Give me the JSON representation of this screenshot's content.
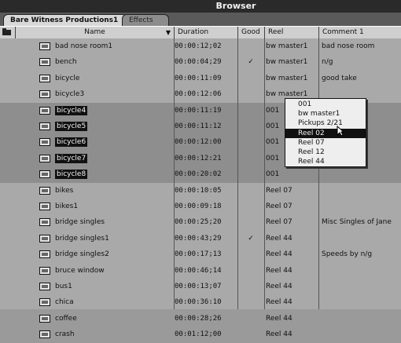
{
  "window": {
    "title": "Browser"
  },
  "tabs": [
    {
      "label": "Bare Witness Productions1",
      "active": true
    },
    {
      "label": "Effects",
      "active": false
    }
  ],
  "columns": {
    "name": "Name",
    "duration": "Duration",
    "good": "Good",
    "reel": "Reel",
    "comment": "Comment 1"
  },
  "rows": [
    {
      "name": "bad nose room1",
      "duration": "00:00:12;02",
      "good": "",
      "reel": "bw master1",
      "comment": "bad nose room",
      "selected": false
    },
    {
      "name": "bench",
      "duration": "00:00:04;29",
      "good": "✓",
      "reel": "bw master1",
      "comment": "n/g",
      "selected": false
    },
    {
      "name": "bicycle",
      "duration": "00:00:11:09",
      "good": "",
      "reel": "bw master1",
      "comment": "good take",
      "selected": false
    },
    {
      "name": "bicycle3",
      "duration": "00:00:12:06",
      "good": "",
      "reel": "bw master1",
      "comment": "",
      "selected": false
    },
    {
      "name": "bicycle4",
      "duration": "00:00:11:19",
      "good": "",
      "reel": "001",
      "comment": "",
      "selected": true
    },
    {
      "name": "bicycle5",
      "duration": "00:00:11:12",
      "good": "",
      "reel": "001",
      "comment": "",
      "selected": true
    },
    {
      "name": "bicycle6",
      "duration": "00:00:12:00",
      "good": "",
      "reel": "001",
      "comment": "",
      "selected": true
    },
    {
      "name": "bicycle7",
      "duration": "00:00:12:21",
      "good": "",
      "reel": "001",
      "comment": "",
      "selected": true
    },
    {
      "name": "bicycle8",
      "duration": "00:00:20:02",
      "good": "",
      "reel": "001",
      "comment": "",
      "selected": true
    },
    {
      "name": "bikes",
      "duration": "00:00:10:05",
      "good": "",
      "reel": "Reel 07",
      "comment": "",
      "selected": false
    },
    {
      "name": "bikes1",
      "duration": "00:00:09:18",
      "good": "",
      "reel": "Reel 07",
      "comment": "",
      "selected": false
    },
    {
      "name": "bridge singles",
      "duration": "00:00:25;20",
      "good": "",
      "reel": "Reel 07",
      "comment": "Misc Singles of Jane",
      "selected": false
    },
    {
      "name": "bridge singles1",
      "duration": "00:00:43;29",
      "good": "✓",
      "reel": "Reel 44",
      "comment": "",
      "selected": false
    },
    {
      "name": "bridge singles2",
      "duration": "00:00:17;13",
      "good": "",
      "reel": "Reel 44",
      "comment": "Speeds by n/g",
      "selected": false
    },
    {
      "name": "bruce window",
      "duration": "00:00:46;14",
      "good": "",
      "reel": "Reel 44",
      "comment": "",
      "selected": false
    },
    {
      "name": "bus1",
      "duration": "00:00:13;07",
      "good": "",
      "reel": "Reel 44",
      "comment": "",
      "selected": false
    },
    {
      "name": "chica",
      "duration": "00:00:36:10",
      "good": "",
      "reel": "Reel 44",
      "comment": "",
      "selected": false
    },
    {
      "name": "coffee",
      "duration": "00:00:28;26",
      "good": "",
      "reel": "Reel 44",
      "comment": "",
      "selected": false
    },
    {
      "name": "crash",
      "duration": "00:01:12;00",
      "good": "",
      "reel": "Reel 44",
      "comment": "",
      "selected": false
    }
  ],
  "reel_popup": {
    "items": [
      "001",
      "bw master1",
      "Pickups 2/21",
      "Reel 02",
      "Reel 07",
      "Reel 12",
      "Reel 44"
    ],
    "highlighted": 3
  },
  "colors": {
    "title_bar": "#2a2a2a",
    "selection": "#111111",
    "background": "#a9a9a9"
  }
}
